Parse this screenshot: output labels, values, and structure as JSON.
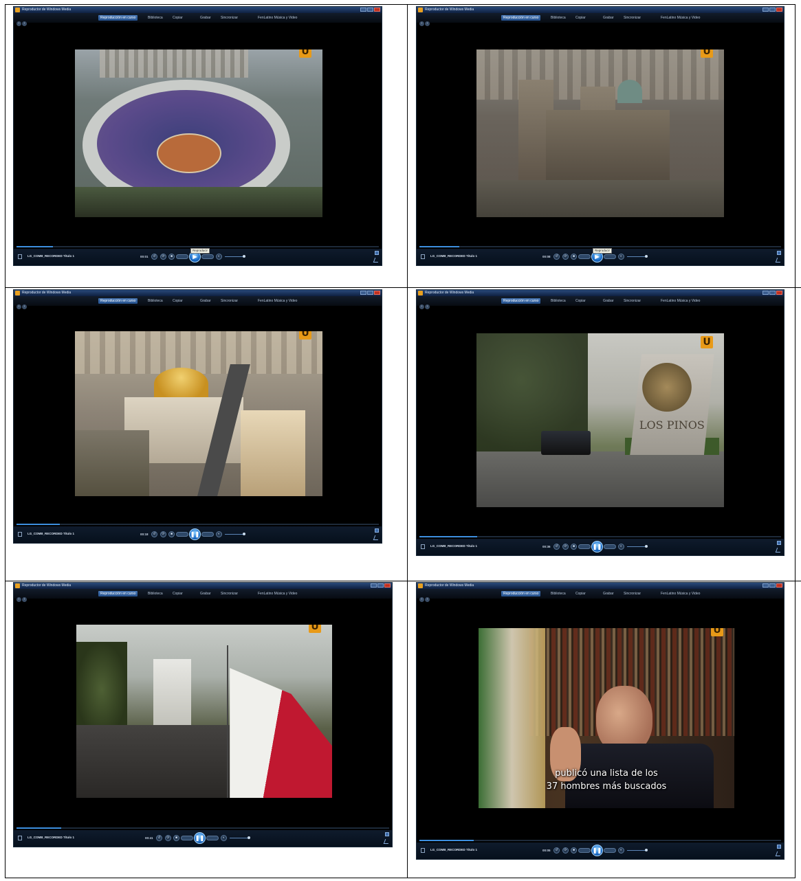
{
  "window": {
    "title": "Reproductor de Windows Media",
    "tabs": [
      "Reproducción en curso",
      "Biblioteca",
      "Copiar",
      "Grabar",
      "Sincronizar",
      "FenLatino Música y Video"
    ],
    "now_playing": "LG_COMB_RECORDED Título 1"
  },
  "panels": [
    {
      "time": "00:01",
      "tooltip": "Reproducir",
      "progress": 0.1
    },
    {
      "time": "00:08",
      "tooltip": "Reproducir",
      "progress": 0.11
    },
    {
      "time": "00:18",
      "tooltip": "",
      "progress": 0.12
    },
    {
      "time": "00:36",
      "tooltip": "",
      "progress": 0.16
    },
    {
      "time": "00:41",
      "tooltip": "",
      "progress": 0.12
    },
    {
      "time": "00:05",
      "tooltip": "",
      "progress": 0.15
    }
  ],
  "scenes": {
    "p4_sign": "LOS PINOS",
    "p6_subtitle_line1": "publicó una lista de los",
    "p6_subtitle_line2": "37 hombres más buscados"
  },
  "logo": "U",
  "colors": {
    "accent": "#3d8fe0",
    "logo": "#e89a18",
    "titlebar": "#2a4a7a"
  }
}
